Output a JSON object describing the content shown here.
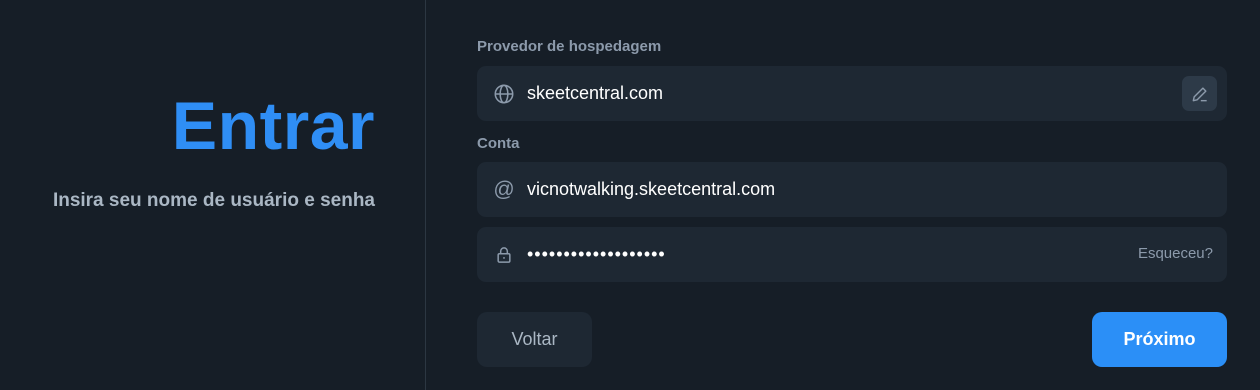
{
  "left": {
    "title": "Entrar",
    "subtitle": "Insira seu nome de usuário e senha"
  },
  "form": {
    "hosting_label": "Provedor de hospedagem",
    "hosting_value": "skeetcentral.com",
    "account_label": "Conta",
    "account_value": "vicnotwalking.skeetcentral.com",
    "account_icon_glyph": "@",
    "password_value": "•••••••••••••••••••",
    "forgot_label": "Esqueceu?"
  },
  "buttons": {
    "back_label": "Voltar",
    "next_label": "Próximo"
  },
  "icons": {
    "hosting": "globe-icon",
    "edit": "pencil-icon",
    "account": "at-sign-icon",
    "password": "lock-icon"
  },
  "colors": {
    "background": "#161e27",
    "field": "#1e2833",
    "accent": "#2f8ef5",
    "muted_text": "#8c9aab"
  }
}
